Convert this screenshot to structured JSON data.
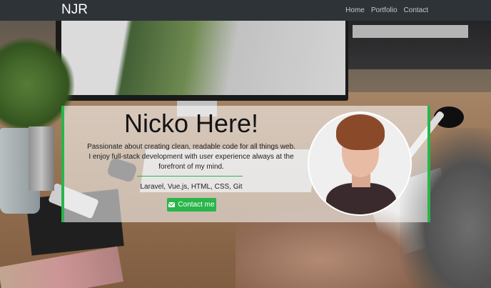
{
  "nav": {
    "brand": "NJR",
    "links": [
      "Home",
      "Portfolio",
      "Contact"
    ]
  },
  "hero": {
    "title": "Nicko Here!",
    "line1": "Passionate about creating clean, readable code for all things web.",
    "line2": "I enjoy full-stack development with user experience always at the forefront of my mind.",
    "skills": "Laravel, Vue.js, HTML, CSS, Git",
    "contact_button": "Contact me"
  },
  "icons": {
    "contact": "envelope-icon"
  },
  "colors": {
    "accent": "#29b54a",
    "navbar": "#2e3338"
  }
}
